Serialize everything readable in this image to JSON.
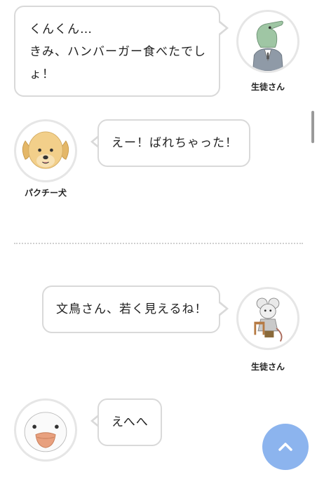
{
  "messages": [
    {
      "speaker": "生徒さん",
      "lines": [
        "くんくん…",
        "きみ、ハンバーガー食べたでし",
        "ょ！"
      ],
      "avatar_icon": "crocodile-student-icon"
    },
    {
      "speaker": "パクチー犬",
      "lines": [
        "えー！ばれちゃった！"
      ],
      "avatar_icon": "golden-dog-icon"
    },
    {
      "speaker": "生徒さん",
      "lines": [
        "文鳥さん、若く見えるね！"
      ],
      "avatar_icon": "mouse-student-icon"
    },
    {
      "speaker": "",
      "lines": [
        "えへへ"
      ],
      "avatar_icon": "java-sparrow-icon"
    }
  ],
  "colors": {
    "accent": "#8cb4ee",
    "bubble_border": "#d9d9d9",
    "divider": "#d0d0d0"
  },
  "scroll_top_icon": "chevron-up-icon"
}
